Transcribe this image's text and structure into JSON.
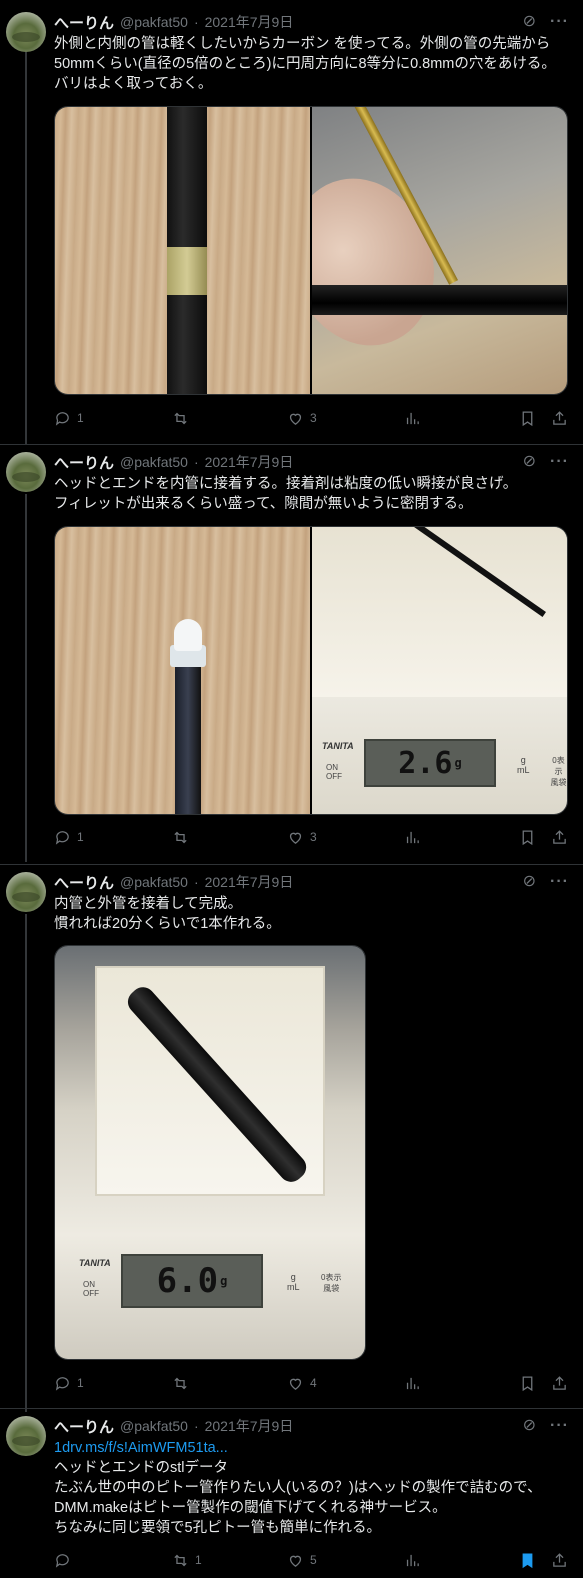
{
  "tweets": [
    {
      "name": "へーりん",
      "handle": "@pakfat50",
      "date": "2021年7月9日",
      "lines": [
        "外側と内側の管は軽くしたいからカーボン を使ってる。外側の管の先端から",
        "50mmくらい(直径の5倍のところ)に円周方向に8等分に0.8mmの穴をあける。",
        "バリはよく取っておく。"
      ],
      "replies": "1",
      "retweets": "",
      "likes": "3",
      "views": ""
    },
    {
      "name": "へーりん",
      "handle": "@pakfat50",
      "date": "2021年7月9日",
      "lines": [
        "ヘッドとエンドを内管に接着する。接着剤は粘度の低い瞬接が良さげ。",
        "フィレットが出来るくらい盛って、隙間が無いように密閉する。"
      ],
      "lcd": "2.6",
      "lcd_unit": "g",
      "replies": "1",
      "retweets": "",
      "likes": "3",
      "views": ""
    },
    {
      "name": "へーりん",
      "handle": "@pakfat50",
      "date": "2021年7月9日",
      "lines": [
        "内管と外管を接着して完成。",
        "慣れれば20分くらいで1本作れる。"
      ],
      "lcd": "6.0",
      "lcd_unit": "g",
      "replies": "1",
      "retweets": "",
      "likes": "4",
      "views": ""
    },
    {
      "name": "へーりん",
      "handle": "@pakfat50",
      "date": "2021年7月9日",
      "link": "1drv.ms/f/s!AimWFM51ta...",
      "lines": [
        "ヘッドとエンドのstlデータ",
        "たぶん世の中のピトー管作りたい人(いるの？)はヘッドの製作で詰むので、",
        "DMM.makeはピトー管製作の閾値下げてくれる神サービス。",
        "ちなみに同じ要領で5孔ピトー管も簡単に作れる。"
      ],
      "replies": "",
      "retweets": "1",
      "likes": "5",
      "views": ""
    }
  ],
  "scale_brand": "TANITA",
  "scale_labels": {
    "on": "ON",
    "off": "OFF",
    "unit_g": "g",
    "unit_ml": "mL",
    "zero": "0表示",
    "tare": "風袋"
  },
  "icons": [
    "grok-icon",
    "more-icon",
    "reply-icon",
    "retweet-icon",
    "like-icon",
    "views-icon",
    "bookmark-icon",
    "share-icon"
  ],
  "colors": {
    "background": "#000000",
    "text": "#e7e9ea",
    "muted": "#71767b",
    "accent": "#1d9bf0"
  }
}
